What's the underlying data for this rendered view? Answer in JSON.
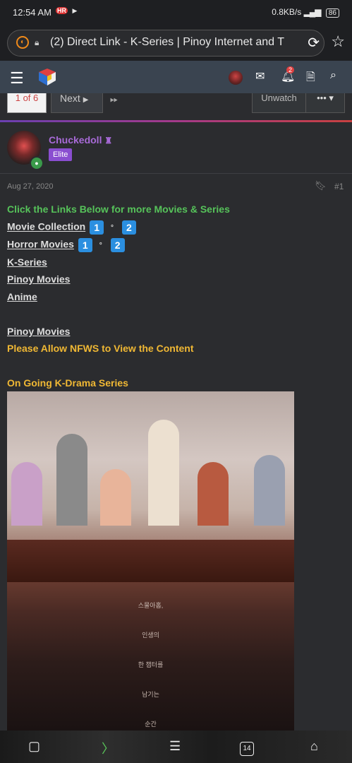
{
  "status_bar": {
    "time": "12:54 AM",
    "badge_hr": "HR",
    "network_speed": "0.8KB/s",
    "battery": "86"
  },
  "browser": {
    "url_text": "(2) Direct Link - K-Series | Pinoy Internet and T",
    "tab_count": "14"
  },
  "site_nav": {
    "alert_count": "2"
  },
  "pagination": {
    "current": "1 of 6",
    "next_label": "Next",
    "unwatch_label": "Unwatch",
    "more_label": "•••"
  },
  "post": {
    "username": "Chuckedoll",
    "user_title": "Elite",
    "date": "Aug 27, 2020",
    "post_number": "#1",
    "heading": "Click the Links Below for more Movies & Series",
    "links": [
      {
        "label": "Movie Collection",
        "n1": "1",
        "n2": "2"
      },
      {
        "label": "Horror Movies",
        "n1": "1",
        "n2": "2"
      },
      {
        "label": "K-Series"
      },
      {
        "label": "Pinoy Movies"
      },
      {
        "label": "Anime"
      }
    ],
    "pinoy_movies_label": "Pinoy Movies",
    "nfws_notice": "Please Allow NFWS to View the Content",
    "ongoing_heading": "On Going K-Drama Series",
    "poster_text": [
      "스물아홉,",
      "인생의",
      "한 챕터를",
      "남기는",
      "순간"
    ]
  },
  "colors": {
    "accent_green": "#56c35a",
    "accent_gold": "#f0b834",
    "username_purple": "#a86ad8",
    "number_blue": "#2b8fe0"
  }
}
